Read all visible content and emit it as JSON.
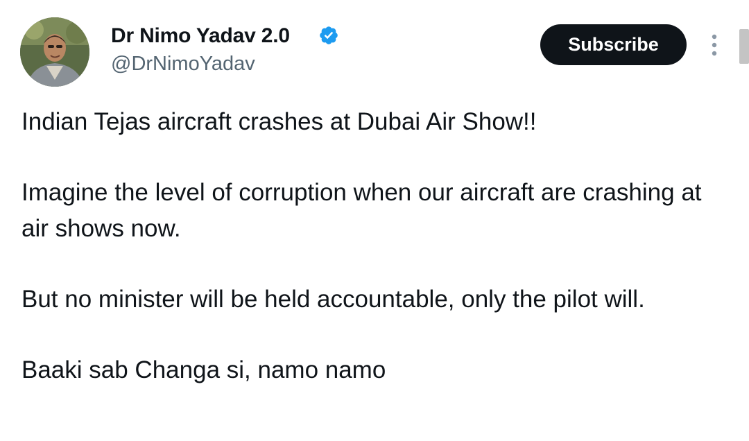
{
  "author": {
    "display_name": "Dr Nimo Yadav 2.0",
    "handle": "@DrNimoYadav",
    "verified": true,
    "avatar_icon": "profile-photo"
  },
  "actions": {
    "subscribe_label": "Subscribe",
    "more_icon": "more-vertical-icon"
  },
  "tweet": {
    "paragraphs": [
      "Indian Tejas aircraft crashes at Dubai Air Show!!",
      "Imagine the level of corruption when our aircraft are crashing at air shows now.",
      "But no minister will be held accountable, only the pilot will.",
      "Baaki sab Changa si, namo namo"
    ]
  },
  "colors": {
    "text_primary": "#0f1419",
    "text_secondary": "#536471",
    "verified_blue": "#1d9bf0",
    "button_bg": "#0f1419",
    "button_text": "#ffffff"
  }
}
